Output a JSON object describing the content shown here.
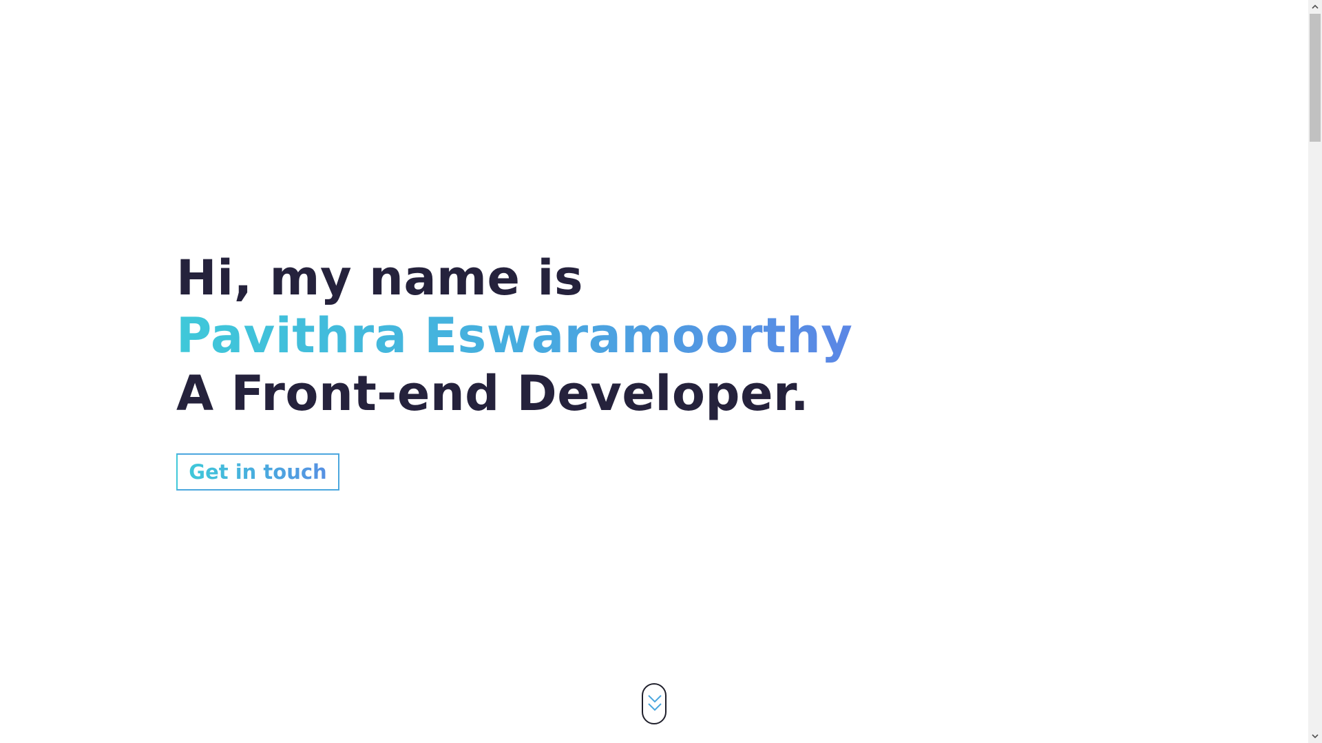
{
  "hero": {
    "line1": "Hi, my name is",
    "name": "Pavithra Eswaramoorthy",
    "line3": "A Front-end Developer."
  },
  "cta": {
    "label": "Get in touch"
  },
  "icons": {
    "scroll_down": "double-chevron-down-icon",
    "scrollbar_up": "arrow-up-icon",
    "scrollbar_down": "arrow-down-icon"
  },
  "colors": {
    "heading": "#25223c",
    "gradient_start": "#3fc8d9",
    "gradient_end": "#5b86e5",
    "background": "#ffffff"
  }
}
